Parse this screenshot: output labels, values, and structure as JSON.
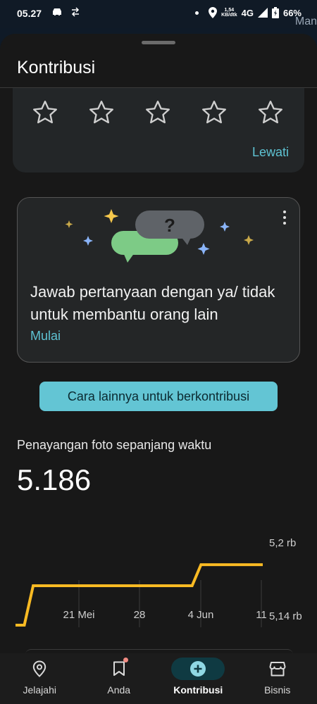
{
  "status_bar": {
    "time": "05.27",
    "speed_value": "1,54",
    "speed_unit": "KB/dtk",
    "network": "4G",
    "battery": "66%",
    "icons": [
      "car-icon",
      "transfer-arrows-icon",
      "dot-icon",
      "location-icon",
      "signal-icon",
      "battery-charging-icon"
    ]
  },
  "map_peek_text": "Man",
  "sheet": {
    "title": "Kontribusi"
  },
  "rating": {
    "star_count": 5,
    "skip_label": "Lewati"
  },
  "question_card": {
    "text": "Jawab pertanyaan dengan ya/ tidak untuk membantu orang lain",
    "start_label": "Mulai",
    "bubble_symbol": "?",
    "colors": {
      "green_bubble": "#7dcb86",
      "gray_bubble": "#5f6368",
      "sparkle_yellow": "#f6c84c",
      "sparkle_blue": "#8ab4f8"
    }
  },
  "more_ways_button": "Cara lainnya untuk berkontribusi",
  "stats": {
    "label": "Penayangan foto sepanjang waktu",
    "value": "5.186"
  },
  "chart_data": {
    "type": "line",
    "ylim": [
      5140,
      5200
    ],
    "ytick_labels": [
      "5,2 rb",
      "5,14 rb"
    ],
    "x_tick_labels": [
      "21 Mei",
      "28",
      "4 Jun",
      "11"
    ],
    "series": [
      {
        "x": [
          0,
          1,
          2,
          20,
          21,
          28
        ],
        "y": [
          5140,
          5140,
          5170,
          5170,
          5186,
          5186
        ]
      }
    ],
    "color": "#f9ba23",
    "grid": "vertical"
  },
  "bottom_nav": [
    {
      "label": "Jelajahi",
      "icon": "location-pin-icon",
      "active": false
    },
    {
      "label": "Anda",
      "icon": "bookmark-icon",
      "active": false,
      "badge": true
    },
    {
      "label": "Kontribusi",
      "icon": "add-circle-icon",
      "active": true
    },
    {
      "label": "Bisnis",
      "icon": "storefront-icon",
      "active": false
    }
  ]
}
